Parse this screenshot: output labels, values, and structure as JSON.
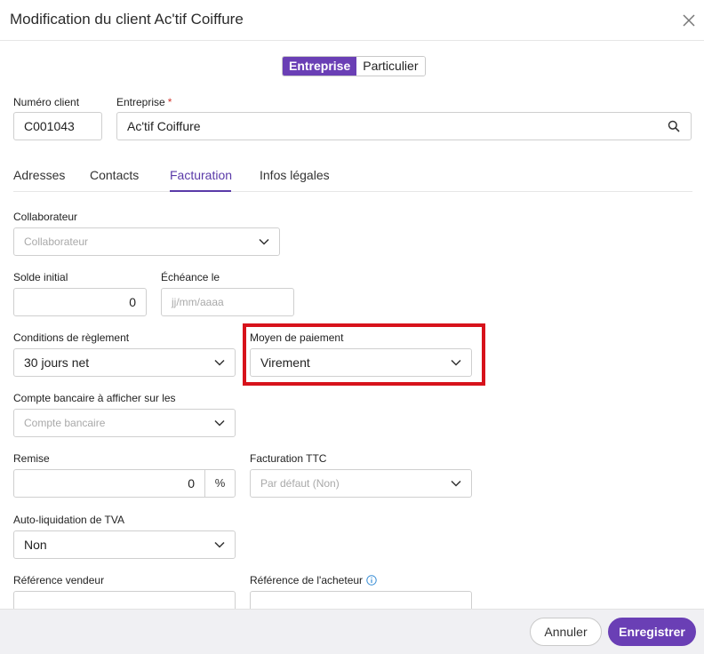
{
  "dialog": {
    "title": "Modification du client Ac'tif Coiffure"
  },
  "client_type": {
    "options": [
      "Entreprise",
      "Particulier"
    ],
    "selected": "Entreprise"
  },
  "client_number": {
    "label": "Numéro client",
    "value": "C001043"
  },
  "company": {
    "label": "Entreprise",
    "required_mark": "*",
    "value": "Ac'tif Coiffure"
  },
  "tabs": [
    {
      "label": "Adresses"
    },
    {
      "label": "Contacts"
    },
    {
      "label": "Facturation"
    },
    {
      "label": "Infos légales"
    }
  ],
  "active_tab": "Facturation",
  "fields": {
    "collaborator": {
      "label": "Collaborateur",
      "placeholder": "Collaborateur"
    },
    "initial_balance": {
      "label": "Solde initial",
      "value": "0"
    },
    "due_date": {
      "label": "Échéance le",
      "placeholder": "jj/mm/aaaa"
    },
    "payment_terms": {
      "label": "Conditions de règlement",
      "value": "30 jours net"
    },
    "payment_method": {
      "label": "Moyen de paiement",
      "value": "Virement"
    },
    "bank_account": {
      "label": "Compte bancaire à afficher sur les",
      "placeholder": "Compte bancaire"
    },
    "discount": {
      "label": "Remise",
      "value": "0",
      "suffix": "%"
    },
    "ttc_billing": {
      "label": "Facturation TTC",
      "placeholder": "Par défaut (Non)"
    },
    "vat_reverse_charge": {
      "label": "Auto-liquidation de TVA",
      "value": "Non"
    },
    "seller_reference": {
      "label": "Référence vendeur"
    },
    "buyer_reference": {
      "label": "Référence de l'acheteur"
    }
  },
  "footer": {
    "cancel_label": "Annuler",
    "save_label": "Enregistrer"
  },
  "colors": {
    "accent": "#6a3fb5",
    "highlight": "#d7121b",
    "required": "#d0342c",
    "info": "#3b8fd6"
  }
}
